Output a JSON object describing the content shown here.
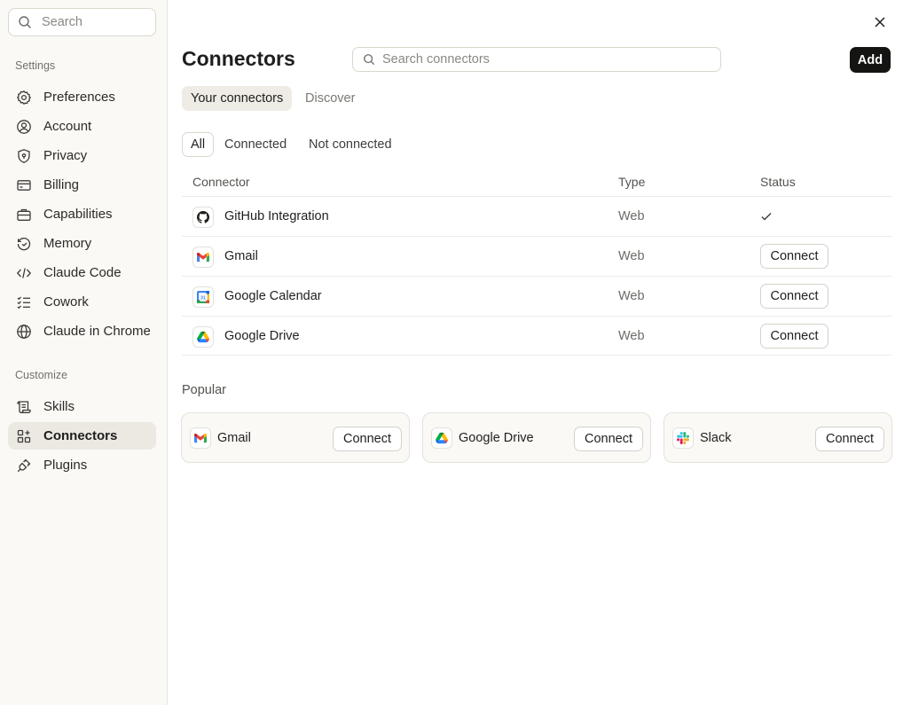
{
  "sidebar": {
    "search_placeholder": "Search",
    "settings_label": "Settings",
    "settings_items": [
      {
        "label": "Preferences",
        "icon": "gear-icon"
      },
      {
        "label": "Account",
        "icon": "user-circle-icon"
      },
      {
        "label": "Privacy",
        "icon": "shield-icon"
      },
      {
        "label": "Billing",
        "icon": "credit-card-icon"
      },
      {
        "label": "Capabilities",
        "icon": "briefcase-icon"
      },
      {
        "label": "Memory",
        "icon": "history-icon"
      },
      {
        "label": "Claude Code",
        "icon": "code-icon"
      },
      {
        "label": "Cowork",
        "icon": "checklist-icon"
      },
      {
        "label": "Claude in Chrome",
        "icon": "globe-icon"
      }
    ],
    "customize_label": "Customize",
    "customize_items": [
      {
        "label": "Skills",
        "icon": "scroll-icon"
      },
      {
        "label": "Connectors",
        "icon": "connectors-icon",
        "active": true
      },
      {
        "label": "Plugins",
        "icon": "plug-icon"
      }
    ]
  },
  "header": {
    "title": "Connectors",
    "search_placeholder": "Search connectors",
    "add_label": "Add"
  },
  "tabs": [
    {
      "label": "Your connectors",
      "active": true
    },
    {
      "label": "Discover",
      "active": false
    }
  ],
  "filters": [
    {
      "label": "All",
      "active": true
    },
    {
      "label": "Connected",
      "active": false
    },
    {
      "label": "Not connected",
      "active": false
    }
  ],
  "table": {
    "columns": [
      "Connector",
      "Type",
      "Status"
    ],
    "rows": [
      {
        "name": "GitHub Integration",
        "type": "Web",
        "status": "connected",
        "icon": "github-icon"
      },
      {
        "name": "Gmail",
        "type": "Web",
        "status": "Connect",
        "icon": "gmail-icon"
      },
      {
        "name": "Google Calendar",
        "type": "Web",
        "status": "Connect",
        "icon": "google-calendar-icon"
      },
      {
        "name": "Google Drive",
        "type": "Web",
        "status": "Connect",
        "icon": "google-drive-icon"
      }
    ]
  },
  "popular": {
    "label": "Popular",
    "cards": [
      {
        "name": "Gmail",
        "button": "Connect",
        "icon": "gmail-icon"
      },
      {
        "name": "Google Drive",
        "button": "Connect",
        "icon": "google-drive-icon"
      },
      {
        "name": "Slack",
        "button": "Connect",
        "icon": "slack-icon"
      }
    ]
  },
  "colors": {
    "sidebar_bg": "#faf9f5",
    "active_nav_bg": "#ebe9e1",
    "primary_button": "#141413"
  }
}
